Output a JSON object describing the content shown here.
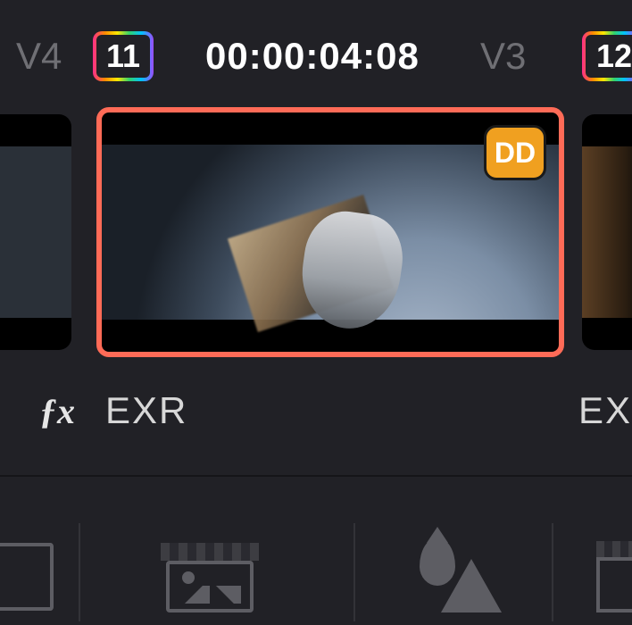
{
  "header": {
    "track_left_label": "V4",
    "track_right_label": "V3",
    "clip_number_left": "11",
    "clip_number_right": "12",
    "timecode": "00:00:04:08"
  },
  "clips": {
    "selected_badge": "DD",
    "label_left": "EXR",
    "label_right": "EXI"
  },
  "icons": {
    "fx": "fx-icon",
    "preview": "thumbnail-preview-icon",
    "qualifier": "qualifier-icon"
  },
  "colors": {
    "selection": "#ff6b57",
    "badge": "#f0a020",
    "bg": "#212126"
  }
}
